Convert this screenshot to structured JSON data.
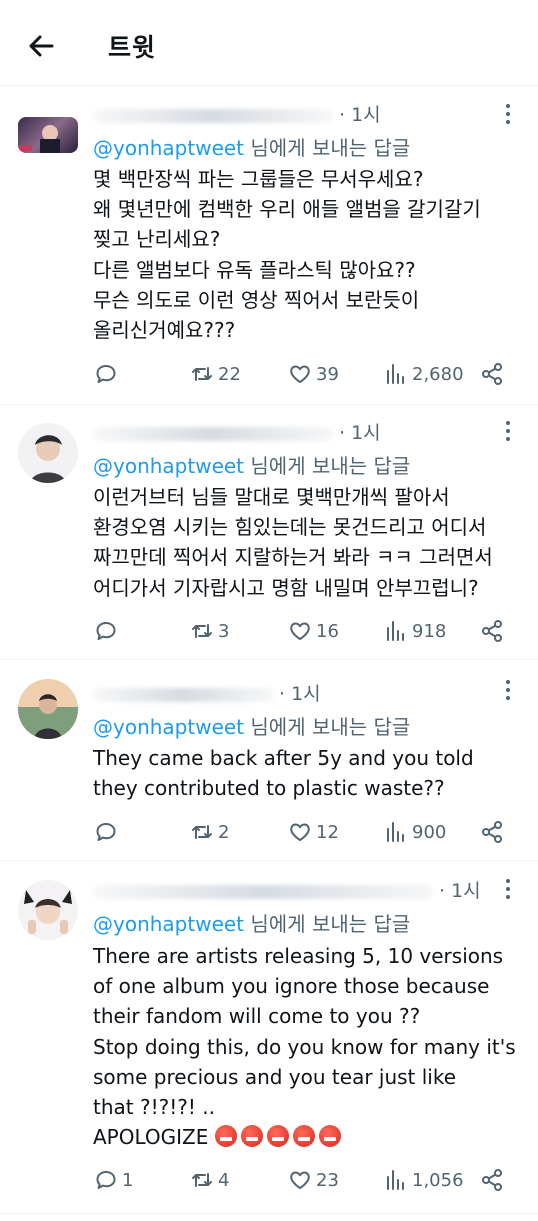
{
  "header": {
    "title": "트윗"
  },
  "tweets": [
    {
      "time": "1시",
      "reply_handle": "@yonhaptweet",
      "reply_suffix": "님에게 보내는 답글",
      "lines": [
        "몇 백만장씩 파는 그룹들은 무서우세요?",
        "왜 몇년만에 컴백한 우리 애들 앨범을 갈기갈기",
        "찢고 난리세요?",
        "다른 앨범보다 유독 플라스틱 많아요??",
        "무슨 의도로 이런 영상 찍어서 보란듯이",
        "올리신거예요???"
      ],
      "replies": "",
      "retweets": "22",
      "likes": "39",
      "views": "2,680"
    },
    {
      "time": "1시",
      "reply_handle": "@yonhaptweet",
      "reply_suffix": "님에게 보내는 답글",
      "lines": [
        "이런거브터 님들 말대로 몇백만개씩 팔아서",
        "환경오염 시키는 힘있는데는 못건드리고 어디서",
        "짜끄만데 찍어서 지랄하는거 봐라 ㅋㅋ 그러면서",
        "어디가서 기자랍시고 명함 내밀며 안부끄럽니?"
      ],
      "replies": "",
      "retweets": "3",
      "likes": "16",
      "views": "918"
    },
    {
      "time": "1시",
      "reply_handle": "@yonhaptweet",
      "reply_suffix": "님에게 보내는 답글",
      "lines": [
        "They came back after 5y and you told",
        "they contributed to plastic waste??"
      ],
      "replies": "",
      "retweets": "2",
      "likes": "12",
      "views": "900"
    },
    {
      "time": "1시",
      "reply_handle": "@yonhaptweet",
      "reply_suffix": "님에게 보내는 답글",
      "lines": [
        "There are artists releasing 5, 10 versions",
        "of one album you ignore those because",
        "their fandom will come to you ??",
        "Stop doing this, do you know for many it's",
        "some precious and you tear just like",
        "that ?!?!?! .."
      ],
      "last_line": "APOLOGIZE",
      "replies": "1",
      "retweets": "4",
      "likes": "23",
      "views": "1,056"
    }
  ]
}
